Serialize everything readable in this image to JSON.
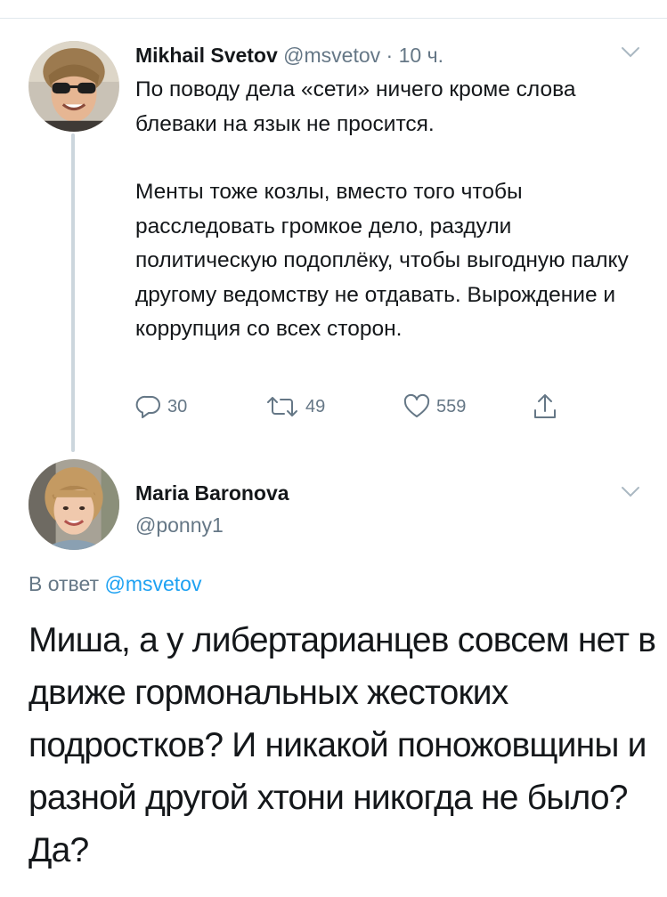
{
  "tweet1": {
    "author_name": "Mikhail Svetov",
    "handle": "@msvetov",
    "separator": "·",
    "time": "10 ч.",
    "paragraphs": [
      "По поводу дела «сети» ничего кроме слова блеваки на язык не просится.",
      "Менты тоже козлы, вместо того чтобы расследовать громкое дело, раздули политическую подоплёку, чтобы выгодную палку другому ведомству не отдавать. Вырождение и коррупция со всех сторон."
    ],
    "actions": {
      "replies": "30",
      "retweets": "49",
      "likes": "559"
    }
  },
  "tweet2": {
    "author_name": "Maria Baronova",
    "handle": "@ponny1",
    "reply_prefix": "В ответ",
    "reply_mention": "@msvetov",
    "text": "Миша, а у либертарианцев совсем нет в движе гормональных жестоких подростков? И никакой поножовщины и разной другой хтони никогда не было? Да?"
  },
  "colors": {
    "text": "#14171a",
    "secondary": "#657786",
    "mention": "#1da1f2",
    "thread_line": "#ccd6dd"
  },
  "icons": [
    "reply-icon",
    "retweet-icon",
    "like-icon",
    "share-icon",
    "chevron-down-icon"
  ]
}
